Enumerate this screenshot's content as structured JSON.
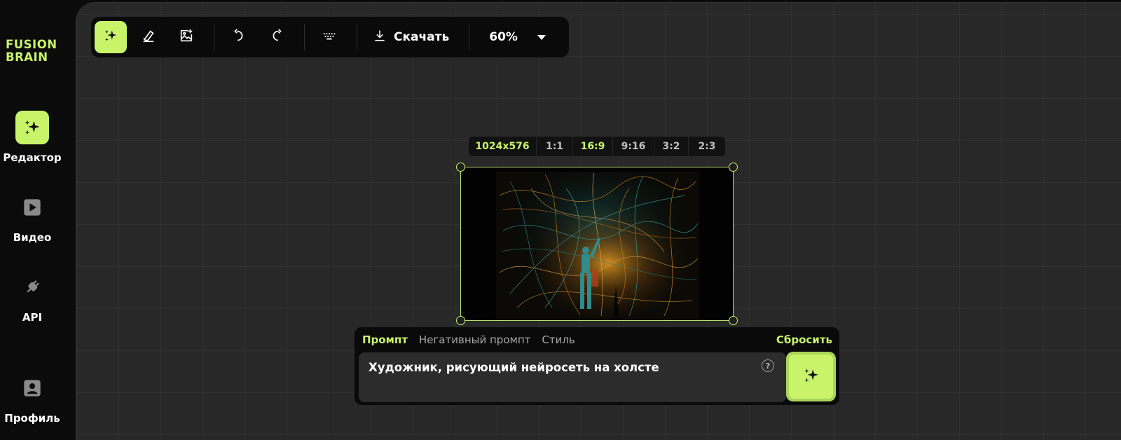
{
  "sidebar": {
    "logo": [
      "FUSION",
      "BRAIN"
    ],
    "items": [
      {
        "label": "Редактор",
        "icon": "sparkles-icon",
        "active": true
      },
      {
        "label": "Видео",
        "icon": "play-icon",
        "active": false
      },
      {
        "label": "API",
        "icon": "plug-icon",
        "active": false
      },
      {
        "label": "Профиль",
        "icon": "profile-icon",
        "active": false
      }
    ]
  },
  "toolbar": {
    "tools": [
      "sparkles-icon",
      "eraser-icon",
      "image-add-icon",
      "undo-icon",
      "redo-icon",
      "keyboard-icon"
    ],
    "download_label": "Скачать",
    "zoom": "60%"
  },
  "ratio_bar": {
    "resolution": "1024x576",
    "ratios": [
      "1:1",
      "16:9",
      "9:16",
      "3:2",
      "2:3"
    ],
    "selected": "16:9"
  },
  "prompt": {
    "tabs": [
      "Промпт",
      "Негативный промпт",
      "Стиль"
    ],
    "active_tab": "Промпт",
    "reset_label": "Сбросить",
    "value": "Художник, рисующий нейросеть на холсте",
    "help": "?"
  },
  "colors": {
    "accent": "#c9f46a",
    "panel": "#0a0a0a",
    "canvas": "#282828"
  }
}
